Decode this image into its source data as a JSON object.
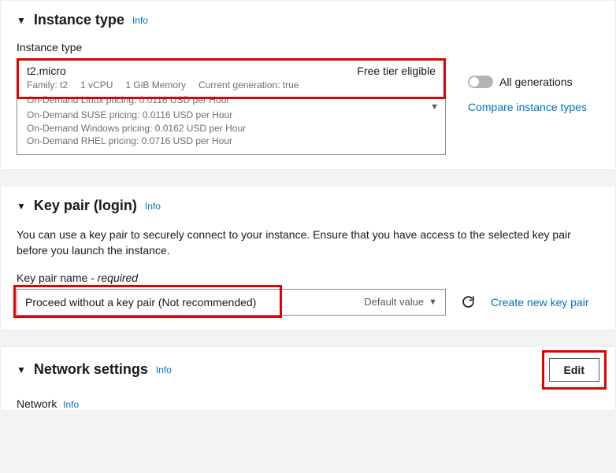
{
  "instanceType": {
    "title": "Instance type",
    "info": "Info",
    "label": "Instance type",
    "selected": {
      "name": "t2.micro",
      "freeTier": "Free tier eligible",
      "family": "Family: t2",
      "vcpu": "1 vCPU",
      "memory": "1 GiB Memory",
      "generation": "Current generation: true"
    },
    "pricing": {
      "linux": "On-Demand Linux pricing: 0.0116 USD per Hour",
      "suse": "On-Demand SUSE pricing: 0.0116 USD per Hour",
      "windows": "On-Demand Windows pricing: 0.0162 USD per Hour",
      "rhel": "On-Demand RHEL pricing: 0.0716 USD per Hour"
    },
    "allGenerations": "All generations",
    "compareLink": "Compare instance types"
  },
  "keyPair": {
    "title": "Key pair (login)",
    "info": "Info",
    "description": "You can use a key pair to securely connect to your instance. Ensure that you have access to the selected key pair before you launch the instance.",
    "label": "Key pair name",
    "required": " - required",
    "selectedValue": "Proceed without a key pair (Not recommended)",
    "defaultValue": "Default value",
    "createLink": "Create new key pair"
  },
  "networkSettings": {
    "title": "Network settings",
    "info": "Info",
    "editBtn": "Edit",
    "networkLabel": "Network",
    "networkInfo": "Info"
  }
}
